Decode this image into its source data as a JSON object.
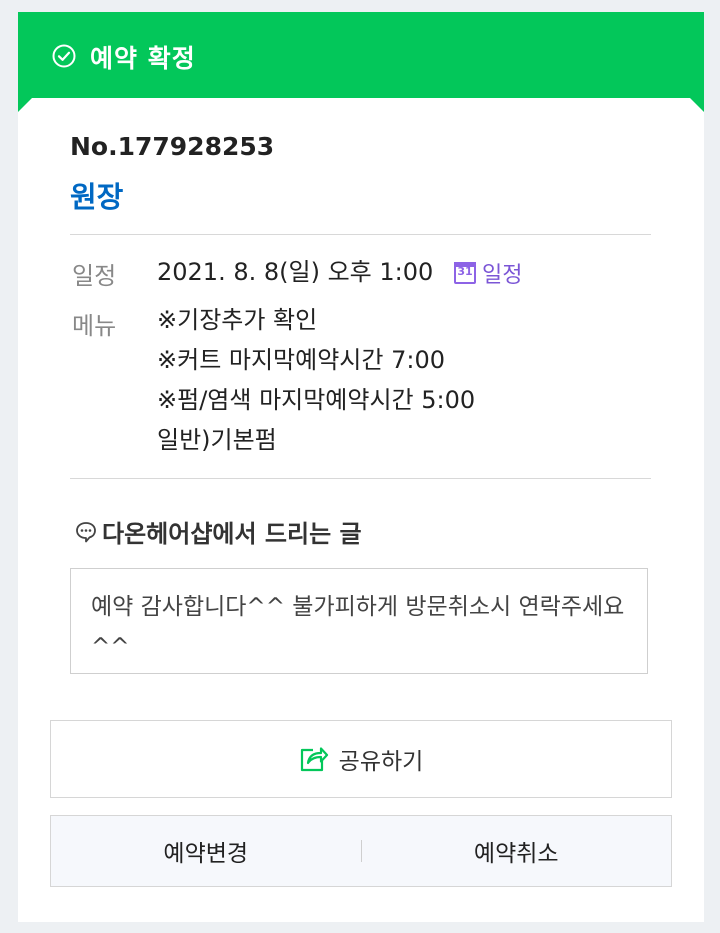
{
  "header": {
    "title": "예약 확정",
    "color": "#03c75a"
  },
  "booking": {
    "number": "No.177928253",
    "shop_name": "원장",
    "schedule_label": "일정",
    "schedule_value": "2021. 8. 8(일) 오후 1:00",
    "calendar_link_label": "일정",
    "calendar_icon_day": "31",
    "menu_label": "메뉴",
    "menu_lines": [
      "※기장추가 확인",
      "※커트 마지막예약시간 7:00",
      "※펌/염색 마지막예약시간 5:00",
      "일반)기본펌"
    ]
  },
  "message": {
    "heading": "다온헤어샵에서 드리는 글",
    "icon": "speech-bubble-icon",
    "body": "예약 감사합니다^^ 불가피하게 방문취소시 연락주세요^^"
  },
  "actions": {
    "share_label": "공유하기",
    "share_icon": "share-icon",
    "change_label": "예약변경",
    "cancel_label": "예약취소"
  }
}
